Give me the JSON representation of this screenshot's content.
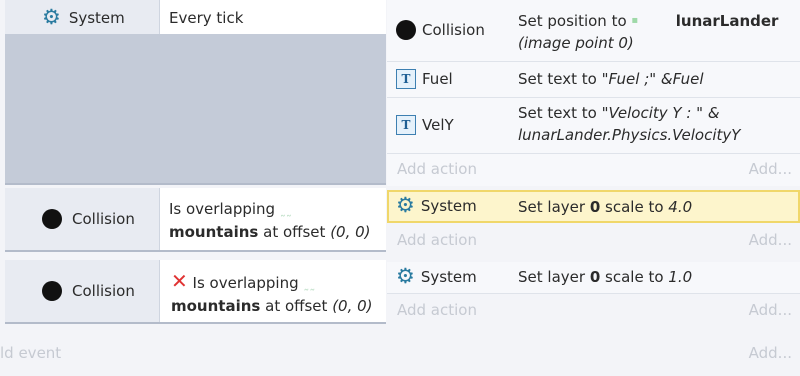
{
  "event1": {
    "object": "System",
    "condition": "Every tick",
    "actions": [
      {
        "object": "Collision",
        "prefix": "Set position to",
        "target": "lunarLander",
        "detail": "(image point 0)"
      },
      {
        "object": "Fuel",
        "prefix": "Set text to",
        "value": "\"Fuel ;\" &Fuel"
      },
      {
        "object": "VelY",
        "prefix": "Set text to",
        "value": "\"Velocity  Y : \" &",
        "value2": "lunarLander.Physics.VelocityY"
      }
    ],
    "add_action": "Add action",
    "add_short": "Add..."
  },
  "event2": {
    "object": "Collision",
    "cond_line1": "Is overlapping",
    "target": "mountains",
    "cond_mid": "at offset",
    "offset": "(0, 0)",
    "action_object": "System",
    "action_prefix": "Set layer",
    "layer": "0",
    "action_mid": "scale to",
    "scale": "4.0",
    "add_action": "Add action",
    "add_short": "Add..."
  },
  "event3": {
    "object": "Collision",
    "cond_line1": "Is overlapping",
    "target": "mountains",
    "cond_mid": "at offset",
    "offset": "(0, 0)",
    "action_object": "System",
    "action_prefix": "Set layer",
    "layer": "0",
    "action_mid": "scale to",
    "scale": "1.0",
    "add_action": "Add action",
    "add_short": "Add..."
  },
  "footer": {
    "add_event": "ld event",
    "add_short": "Add..."
  },
  "colors": {
    "highlight": "#fdf5cc",
    "gear": "#2a7ba0",
    "invert": "#e03333"
  }
}
